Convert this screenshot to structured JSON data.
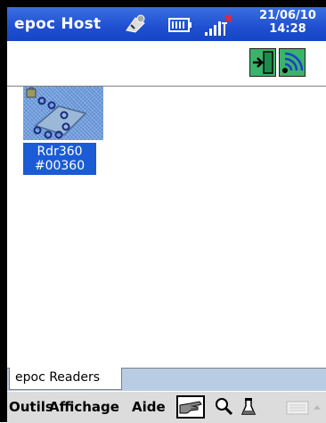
{
  "titlebar": {
    "app_title": "epoc Host",
    "date": "21/06/10",
    "time": "14:28"
  },
  "toolbar": {
    "buttons": [
      {
        "icon": "exit-door-icon"
      },
      {
        "icon": "wireless-signal-icon"
      }
    ]
  },
  "readers": [
    {
      "name": "Rdr360",
      "serial": "#00360",
      "icon": "reader-device-icon"
    }
  ],
  "tabs": [
    {
      "label": "epoc Readers"
    }
  ],
  "menubar": {
    "items": [
      "Outils",
      "Affichage",
      "Aide"
    ]
  },
  "colors": {
    "title_bar": "#2458d6",
    "selection": "#1a5bd6",
    "tab_strip": "#b8cce4",
    "menu_bar": "#dcdcdc",
    "button_green": "#3bb36a"
  }
}
